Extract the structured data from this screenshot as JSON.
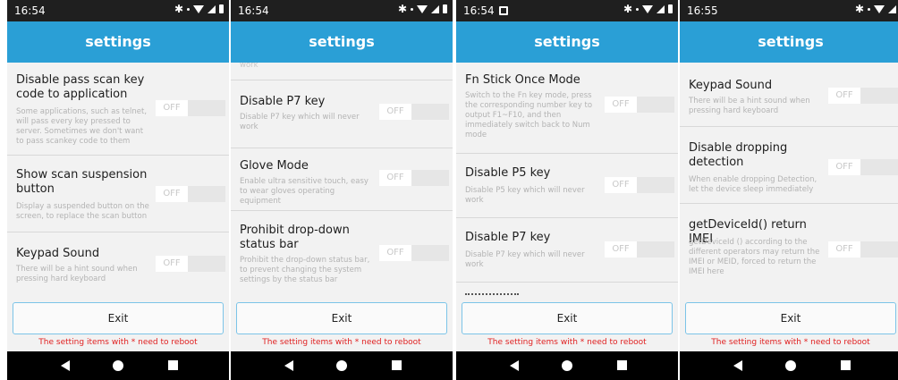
{
  "shared": {
    "title": "settings",
    "exit_label": "Exit",
    "reboot_note": "The setting items with * need to reboot",
    "toggle_label": "OFF"
  },
  "screens": [
    {
      "time": "16:54",
      "items": [
        {
          "title": "Disable pass scan key code to application",
          "desc": "Some applications, such as telnet, will pass every key pressed to server. Sometimes we don't want to pass scankey code to them",
          "toggle": "OFF"
        },
        {
          "title": "Show scan suspension button",
          "desc": "Display a suspended button on the screen, to replace the scan button",
          "toggle": "OFF"
        },
        {
          "title": "Keypad Sound",
          "desc": "There will be a hint sound when pressing hard keyboard",
          "toggle": "OFF"
        }
      ]
    },
    {
      "time": "16:54",
      "partial_top": "work",
      "items": [
        {
          "title": "Disable P7 key",
          "desc": "Disable P7 key which will never work",
          "toggle": "OFF"
        },
        {
          "title": "Glove Mode",
          "desc": "Enable ultra sensitive touch, easy to wear gloves operating equipment",
          "toggle": "OFF"
        },
        {
          "title": "Prohibit drop-down status bar",
          "desc": "Prohibit the drop-down status bar, to prevent changing the system settings by the status bar",
          "toggle": "OFF"
        }
      ]
    },
    {
      "time": "16:54",
      "items": [
        {
          "title": "Fn Stick Once Mode",
          "desc": "Switch to the Fn key mode, press the corresponding number key to output F1~F10, and then immediately switch back to Num mode",
          "toggle": "OFF"
        },
        {
          "title": "Disable P5 key",
          "desc": "Disable P5 key which will never work",
          "toggle": "OFF"
        },
        {
          "title": "Disable P7 key",
          "desc": "Disable P7 key which will never work",
          "toggle": "OFF"
        }
      ]
    },
    {
      "time": "16:55",
      "items": [
        {
          "title": "Keypad Sound",
          "desc": "There will be a hint sound when pressing hard keyboard",
          "toggle": "OFF"
        },
        {
          "title": "Disable dropping detection",
          "desc": "When enable dropping Detection, let the device sleep immediately",
          "toggle": "OFF"
        },
        {
          "title": "getDeviceId() return IMEI",
          "desc": "getDeviceId () according to the different operators may return the IMEI or MEID, forced to return the IMEI here",
          "toggle": "OFF"
        }
      ]
    }
  ]
}
